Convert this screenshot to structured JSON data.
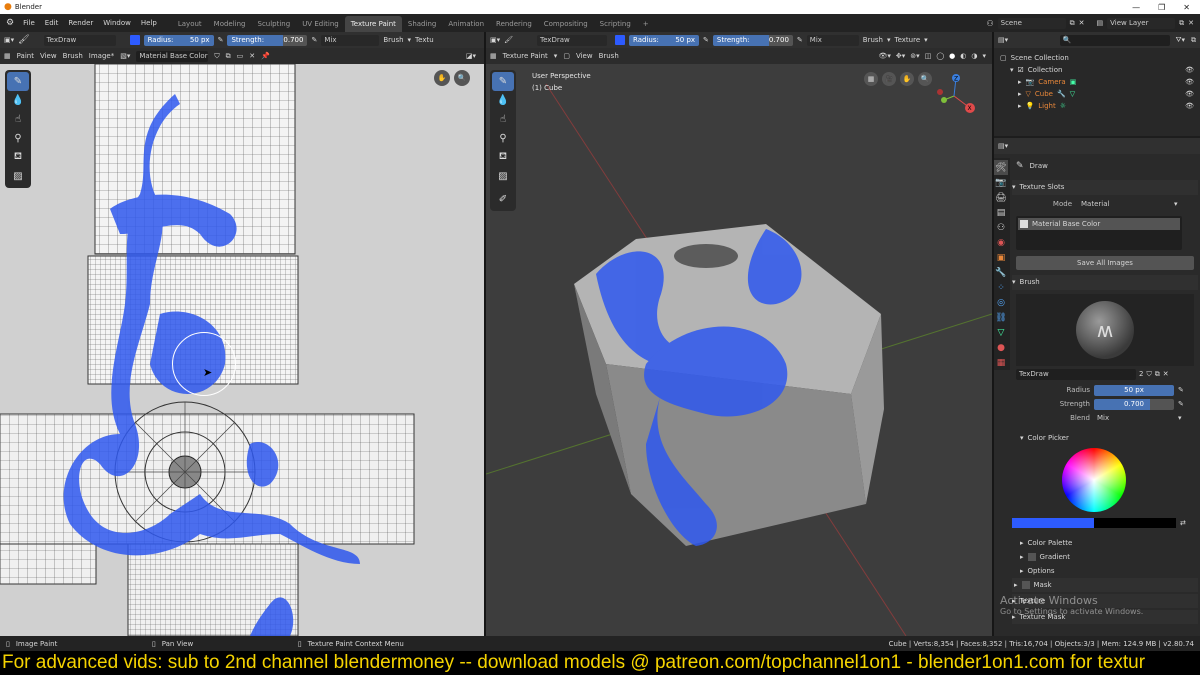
{
  "app": {
    "title": "Blender",
    "icon": "blender-icon"
  },
  "window_controls": [
    "—",
    "❐",
    "✕"
  ],
  "menus": [
    "File",
    "Edit",
    "Render",
    "Window",
    "Help"
  ],
  "workspaces": [
    "Layout",
    "Modeling",
    "Sculpting",
    "UV Editing",
    "Texture Paint",
    "Shading",
    "Animation",
    "Rendering",
    "Compositing",
    "Scripting"
  ],
  "workspace_add": "+",
  "scene": {
    "label": "Scene"
  },
  "view_layer": {
    "label": "View Layer"
  },
  "tool_header": {
    "brush_name": "TexDraw",
    "radius_label": "Radius:",
    "radius_value": "50 px",
    "strength_label": "Strength:",
    "strength_value": "0.700",
    "blend": "Mix",
    "brush_menu": "Brush",
    "texture_menu": "Textu",
    "texture_menu_right": "Texture",
    "colors": {
      "brush": "#2d5bff",
      "accent": "#4772b3"
    }
  },
  "image_editor": {
    "mode": "Paint",
    "menus": [
      "View",
      "Brush",
      "Image*"
    ],
    "image_name": "Material Base Color",
    "paint_color": "#3a5ee0"
  },
  "viewport": {
    "mode": "Texture Paint",
    "menus": [
      "View",
      "Brush"
    ],
    "overlay_line1": "User Perspective",
    "overlay_line2": "(1) Cube",
    "axis_x": "X",
    "axis_y": "Y",
    "axis_z": "Z"
  },
  "outliner": {
    "search_placeholder": "",
    "root": "Scene Collection",
    "collection": "Collection",
    "items": [
      {
        "name": "Camera",
        "color": "#e8873a"
      },
      {
        "name": "Cube",
        "color": "#e8873a"
      },
      {
        "name": "Light",
        "color": "#e8873a"
      }
    ]
  },
  "properties": {
    "tool_name": "Draw",
    "texture_slots_label": "Texture Slots",
    "mode_label": "Mode",
    "mode_value": "Material",
    "slot_name": "Material Base Color",
    "save_all": "Save All Images",
    "brush_label": "Brush",
    "brush_name": "TexDraw",
    "brush_users": "2",
    "radius_label": "Radius",
    "radius_value": "50 px",
    "strength_label": "Strength",
    "strength_value": "0.700",
    "blend_label": "Blend",
    "blend_value": "Mix",
    "color_picker_label": "Color Picker",
    "color_palette_label": "Color Palette",
    "gradient_label": "Gradient",
    "options_label": "Options",
    "mask_label": "Mask",
    "texture_label": "Texture",
    "texture_mask_label": "Texture Mask"
  },
  "watermark": {
    "line1": "Activate Windows",
    "line2": "Go to Settings to activate Windows."
  },
  "statusbar": {
    "left": "Image Paint",
    "middle": "Pan View",
    "right": "Texture Paint Context Menu",
    "stats": "Cube | Verts:8,354 | Faces:8,352 | Tris:16,704 | Objects:3/3 | Mem: 124.9 MB | v2.80.74"
  },
  "banner": {
    "text": "For advanced vids: sub to 2nd channel blendermoney -- download models @ patreon.com/topchannel1on1 - blender1on1.com for textur",
    "color": "#f5d300"
  }
}
